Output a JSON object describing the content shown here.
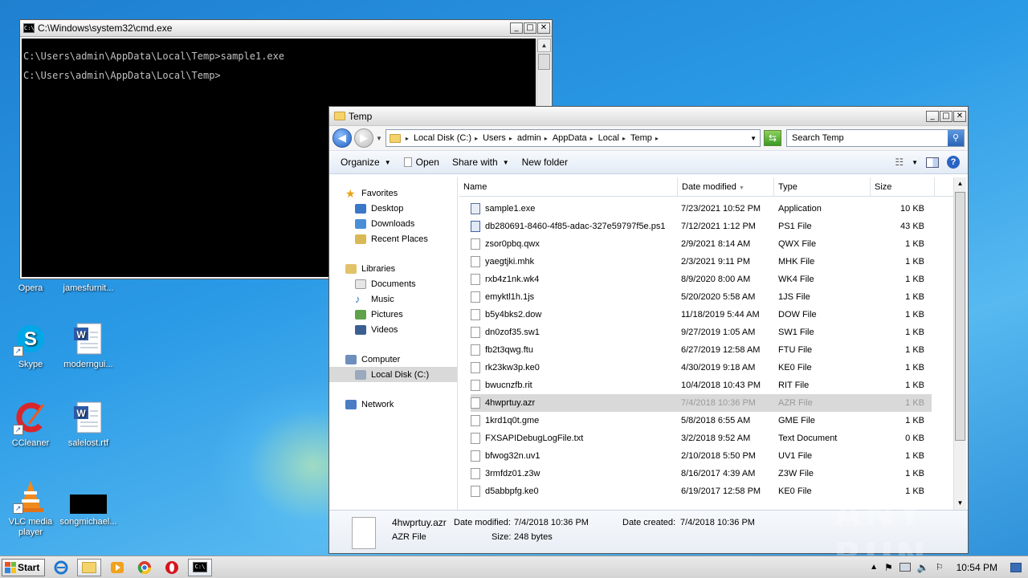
{
  "desktop": {
    "icons": [
      {
        "label": "Opera"
      },
      {
        "label": "jamesfurnit..."
      },
      {
        "label": "Skype"
      },
      {
        "label": "moderngui..."
      },
      {
        "label": "CCleaner"
      },
      {
        "label": "salelost.rtf"
      },
      {
        "label": "VLC media player"
      },
      {
        "label": "songmichael..."
      }
    ]
  },
  "cmd": {
    "title": "C:\\Windows\\system32\\cmd.exe",
    "lines": [
      "C:\\Users\\admin\\AppData\\Local\\Temp>sample1.exe",
      "C:\\Users\\admin\\AppData\\Local\\Temp>"
    ]
  },
  "explorer": {
    "title": "Temp",
    "breadcrumb": [
      "Local Disk (C:)",
      "Users",
      "admin",
      "AppData",
      "Local",
      "Temp"
    ],
    "search_placeholder": "Search Temp",
    "toolbar": {
      "organize": "Organize",
      "open": "Open",
      "share_with": "Share with",
      "new_folder": "New folder"
    },
    "nav": {
      "favorites": "Favorites",
      "favorites_items": [
        "Desktop",
        "Downloads",
        "Recent Places"
      ],
      "libraries": "Libraries",
      "libraries_items": [
        "Documents",
        "Music",
        "Pictures",
        "Videos"
      ],
      "computer": "Computer",
      "computer_items": [
        "Local Disk (C:)"
      ],
      "network": "Network"
    },
    "columns": {
      "name": "Name",
      "date": "Date modified",
      "type": "Type",
      "size": "Size"
    },
    "files": [
      {
        "name": "sample1.exe",
        "date": "7/23/2021 10:52 PM",
        "type": "Application",
        "size": "10 KB"
      },
      {
        "name": "db280691-8460-4f85-adac-327e59797f5e.ps1",
        "date": "7/12/2021 1:12 PM",
        "type": "PS1 File",
        "size": "43 KB"
      },
      {
        "name": "zsor0pbq.qwx",
        "date": "2/9/2021 8:14 AM",
        "type": "QWX File",
        "size": "1 KB"
      },
      {
        "name": "yaegtjki.mhk",
        "date": "2/3/2021 9:11 PM",
        "type": "MHK File",
        "size": "1 KB"
      },
      {
        "name": "rxb4z1nk.wk4",
        "date": "8/9/2020 8:00 AM",
        "type": "WK4 File",
        "size": "1 KB"
      },
      {
        "name": "emyktl1h.1js",
        "date": "5/20/2020 5:58 AM",
        "type": "1JS File",
        "size": "1 KB"
      },
      {
        "name": "b5y4bks2.dow",
        "date": "11/18/2019 5:44 AM",
        "type": "DOW File",
        "size": "1 KB"
      },
      {
        "name": "dn0zof35.sw1",
        "date": "9/27/2019 1:05 AM",
        "type": "SW1 File",
        "size": "1 KB"
      },
      {
        "name": "fb2t3qwg.ftu",
        "date": "6/27/2019 12:58 AM",
        "type": "FTU File",
        "size": "1 KB"
      },
      {
        "name": "rk23kw3p.ke0",
        "date": "4/30/2019 9:18 AM",
        "type": "KE0 File",
        "size": "1 KB"
      },
      {
        "name": "bwucnzfb.rit",
        "date": "10/4/2018 10:43 PM",
        "type": "RIT File",
        "size": "1 KB"
      },
      {
        "name": "4hwprtuy.azr",
        "date": "7/4/2018 10:36 PM",
        "type": "AZR File",
        "size": "1 KB"
      },
      {
        "name": "1krd1q0t.gme",
        "date": "5/8/2018 6:55 AM",
        "type": "GME File",
        "size": "1 KB"
      },
      {
        "name": "FXSAPIDebugLogFile.txt",
        "date": "3/2/2018 9:52 AM",
        "type": "Text Document",
        "size": "0 KB"
      },
      {
        "name": "bfwog32n.uv1",
        "date": "2/10/2018 5:50 PM",
        "type": "UV1 File",
        "size": "1 KB"
      },
      {
        "name": "3rmfdz01.z3w",
        "date": "8/16/2017 4:39 AM",
        "type": "Z3W File",
        "size": "1 KB"
      },
      {
        "name": "d5abbpfg.ke0",
        "date": "6/19/2017 12:58 PM",
        "type": "KE0 File",
        "size": "1 KB"
      }
    ],
    "selected_index": 11,
    "details": {
      "name": "4hwprtuy.azr",
      "type": "AZR File",
      "modified_label": "Date modified:",
      "modified": "7/4/2018 10:36 PM",
      "created_label": "Date created:",
      "created": "7/4/2018 10:36 PM",
      "size_label": "Size:",
      "size": "248 bytes"
    }
  },
  "taskbar": {
    "start": "Start",
    "clock": "10:54 PM"
  },
  "watermark": "ANY RUN"
}
